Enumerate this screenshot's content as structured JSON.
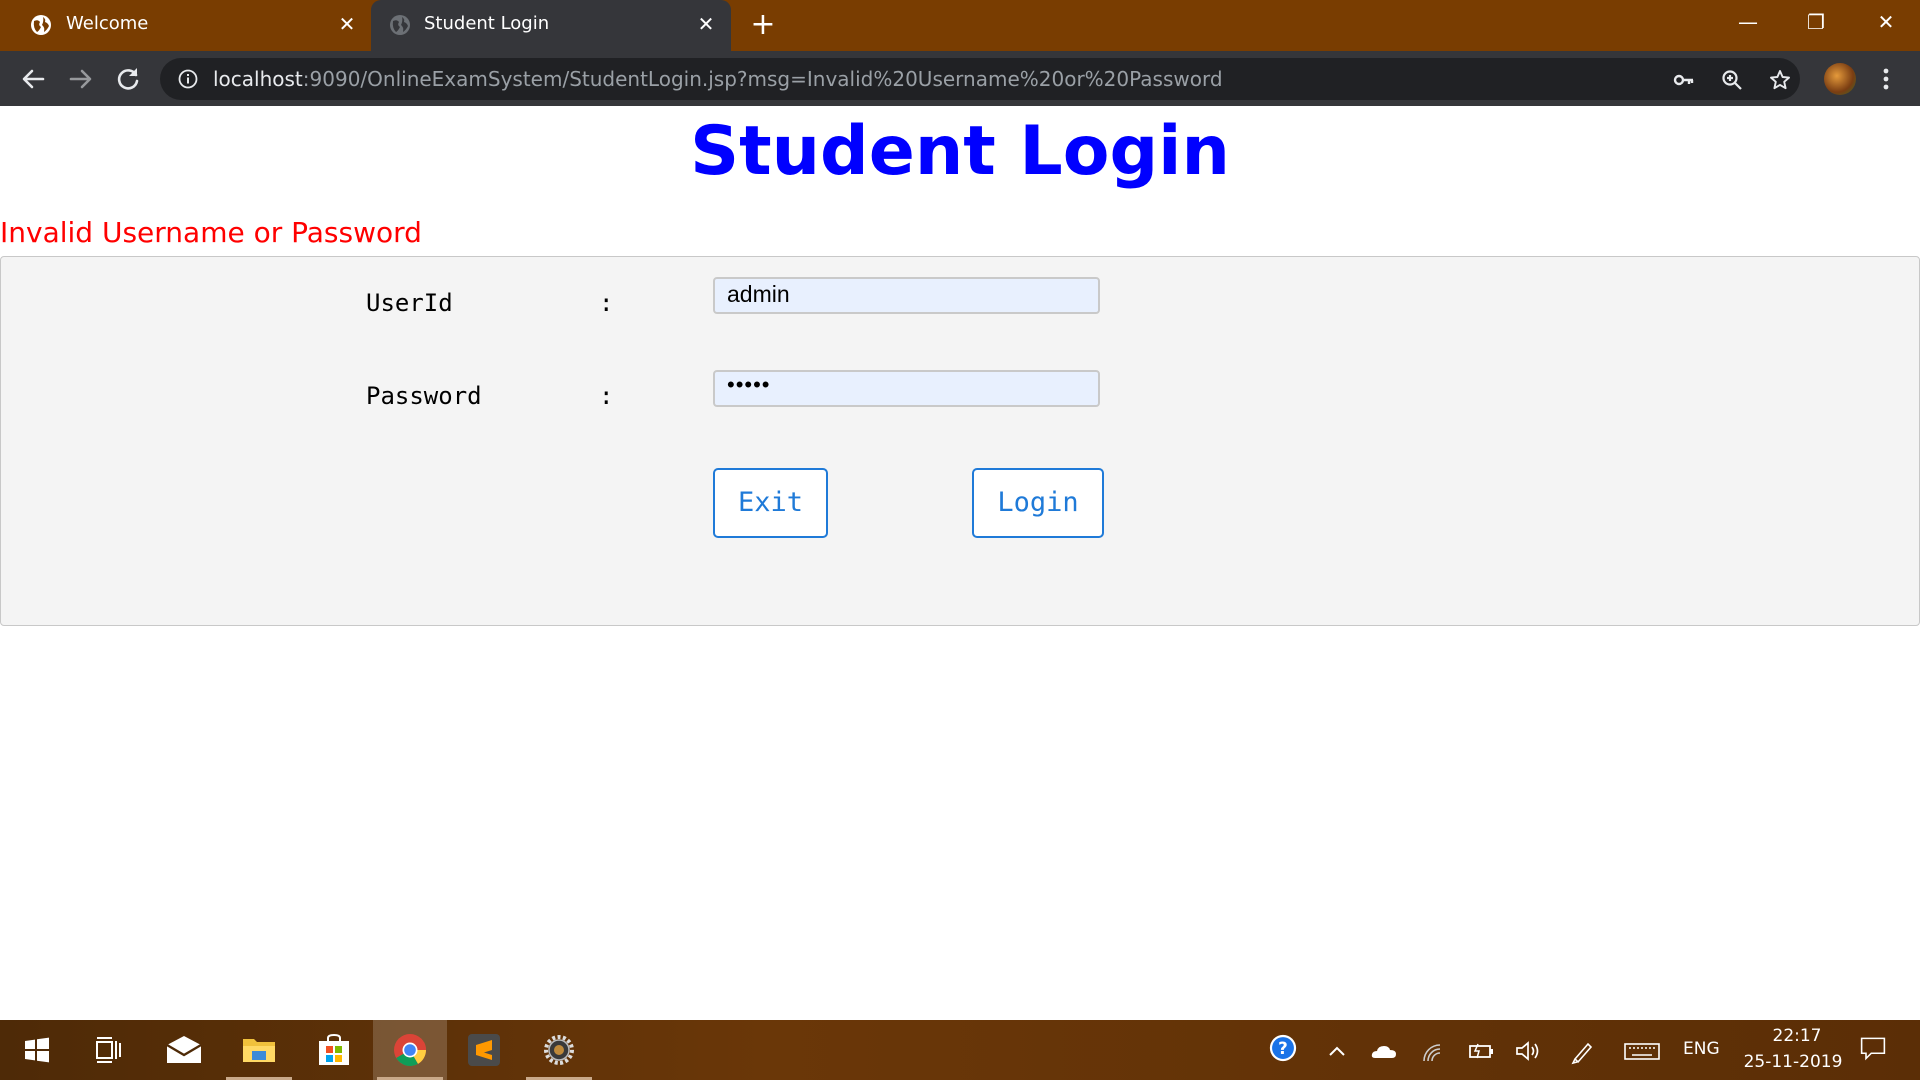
{
  "browser": {
    "tabs": [
      {
        "title": "Welcome"
      },
      {
        "title": "Student Login"
      }
    ],
    "close_glyph": "✕",
    "new_tab_glyph": "+",
    "window_controls": {
      "minimize": "—",
      "restore": "❐",
      "close": "✕"
    },
    "url": {
      "host": "localhost",
      "rest": ":9090/OnlineExamSystem/StudentLogin.jsp?msg=Invalid%20Username%20or%20Password"
    }
  },
  "page": {
    "title": "Student Login",
    "error_message": "Invalid Username or Password",
    "form": {
      "userid_label": "UserId",
      "password_label": "Password",
      "colon": ":",
      "userid_value": "admin",
      "password_value": "•••••",
      "exit_label": "Exit",
      "login_label": "Login"
    }
  },
  "taskbar": {
    "language": "ENG",
    "time": "22:17",
    "date": "25-11-2019",
    "apps": [
      "windows-start",
      "task-view",
      "mail",
      "file-explorer",
      "store",
      "chrome",
      "sublime-text",
      "settings-app"
    ]
  },
  "colors": {
    "title_blue": "#0000ff",
    "error_red": "#ff0000",
    "button_blue": "#1f7ad8",
    "tabstrip": "#793d01"
  }
}
